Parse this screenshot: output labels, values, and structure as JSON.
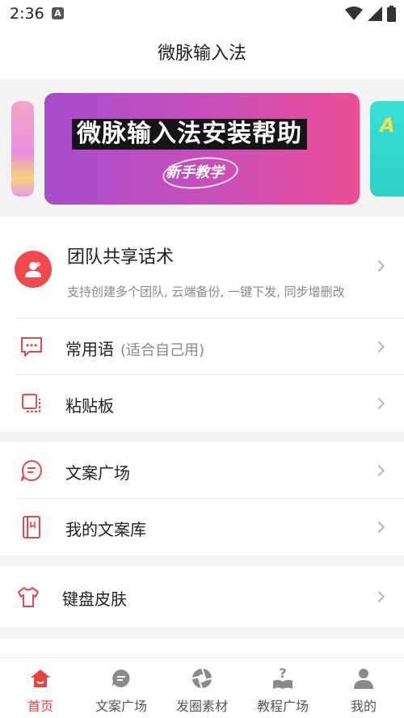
{
  "status_bar": {
    "time": "2:36",
    "notification_icon": "A"
  },
  "app_bar": {
    "title": "微脉输入法"
  },
  "banner": {
    "title": "微脉输入法安装帮助",
    "subtitle": "新手教学",
    "next_preview_text": "A",
    "slide_count": 2,
    "active_slide": 0
  },
  "team": {
    "title": "团队共享话术",
    "description": "支持创建多个团队, 云端备份, 一键下发, 同步增删改"
  },
  "section1": [
    {
      "label": "常用语",
      "note": "(适合自己用)",
      "icon": "message-bubble-icon"
    },
    {
      "label": "粘贴板",
      "note": "",
      "icon": "clipboard-icon"
    }
  ],
  "section2": [
    {
      "label": "文案广场",
      "icon": "chat-lines-icon"
    },
    {
      "label": "我的文案库",
      "icon": "book-icon"
    }
  ],
  "section3": [
    {
      "label": "键盘皮肤",
      "icon": "tshirt-icon"
    }
  ],
  "bottom_nav": [
    {
      "label": "首页",
      "icon": "home-icon",
      "active": true
    },
    {
      "label": "文案广场",
      "icon": "chat-icon",
      "active": false
    },
    {
      "label": "发圈素材",
      "icon": "aperture-icon",
      "active": false
    },
    {
      "label": "教程广场",
      "icon": "question-book-icon",
      "active": false
    },
    {
      "label": "我的",
      "icon": "user-icon",
      "active": false
    }
  ],
  "colors": {
    "accent": "#e94040",
    "icon_red": "#e34a4a",
    "gray": "#888888"
  }
}
